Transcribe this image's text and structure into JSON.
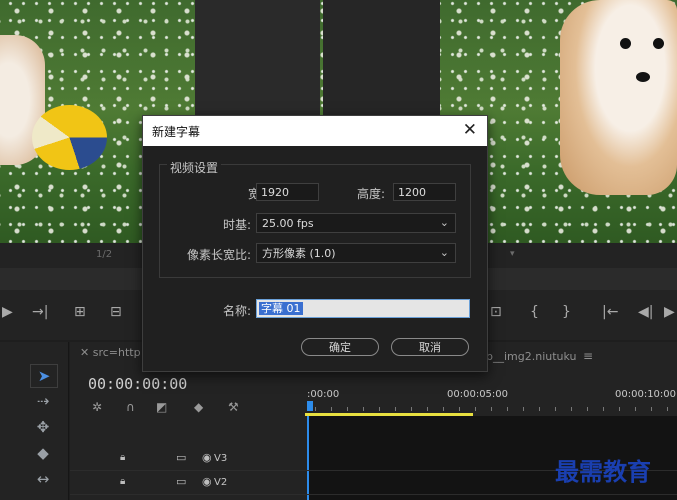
{
  "monitor": {
    "page_indicator": "1/2"
  },
  "dialog": {
    "title": "新建字幕",
    "close_glyph": "✕",
    "video_settings": {
      "legend": "视频设置",
      "width_label": "宽度:",
      "width_value": "1920",
      "height_label": "高度:",
      "height_value": "1200",
      "timebase_label": "时基:",
      "timebase_value": "25.00 fps",
      "pixel_aspect_label": "像素长宽比:",
      "pixel_aspect_value": "方形像素 (1.0)"
    },
    "name_label": "名称:",
    "name_value": "字幕 01",
    "ok_label": "确定",
    "cancel_label": "取消"
  },
  "timeline": {
    "tab_label": "src=http",
    "tab_label_right": "p__img2.niutuku",
    "menu_glyph": "≡",
    "timecode": "00:00:00:00",
    "ruler": [
      ":00:00",
      "00:00:05:00",
      "00:00:10:00"
    ],
    "tracks": [
      "V3",
      "V2"
    ]
  },
  "watermark": "最需教育",
  "colors": {
    "accent": "#3a6fd0",
    "playhead": "#2d8ceb",
    "work_area": "#e8e040"
  }
}
